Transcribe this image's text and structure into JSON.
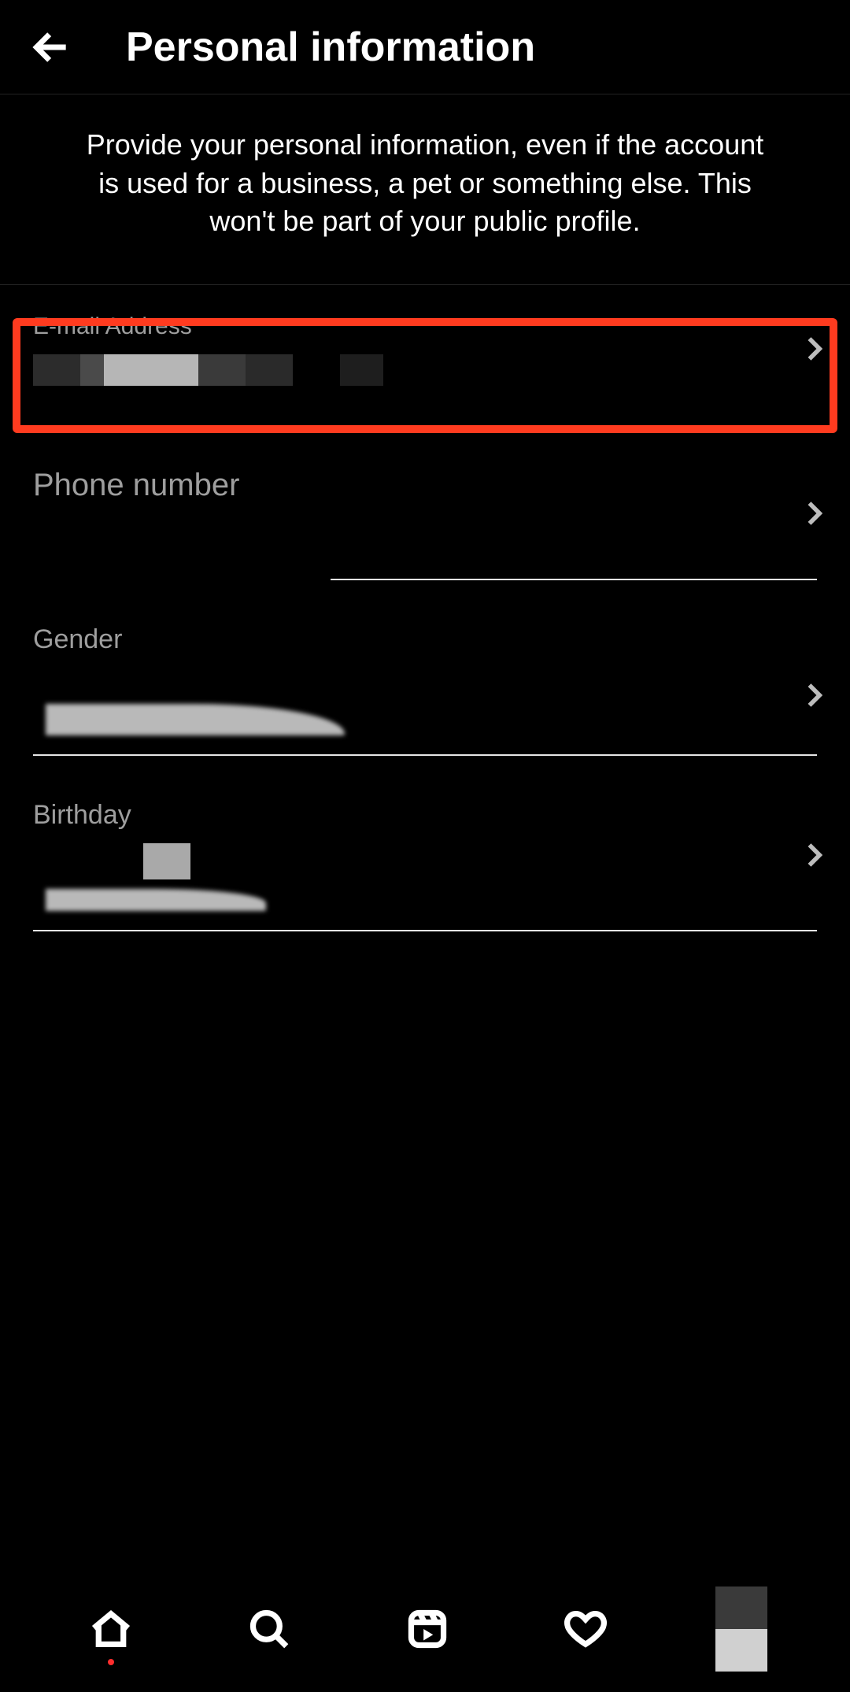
{
  "header": {
    "title": "Personal information"
  },
  "description": "Provide your personal information, even if the account is used for a business, a pet or something else. This won't be part of your public profile.",
  "rows": {
    "email": {
      "label": "E-mail Address"
    },
    "phone": {
      "label": "Phone number"
    },
    "gender": {
      "label": "Gender"
    },
    "birthday": {
      "label": "Birthday"
    }
  },
  "nav": {
    "home": "home-icon",
    "search": "search-icon",
    "reels": "reels-icon",
    "activity": "heart-icon",
    "profile": "profile-avatar"
  },
  "highlight_color": "#ff3b1f"
}
